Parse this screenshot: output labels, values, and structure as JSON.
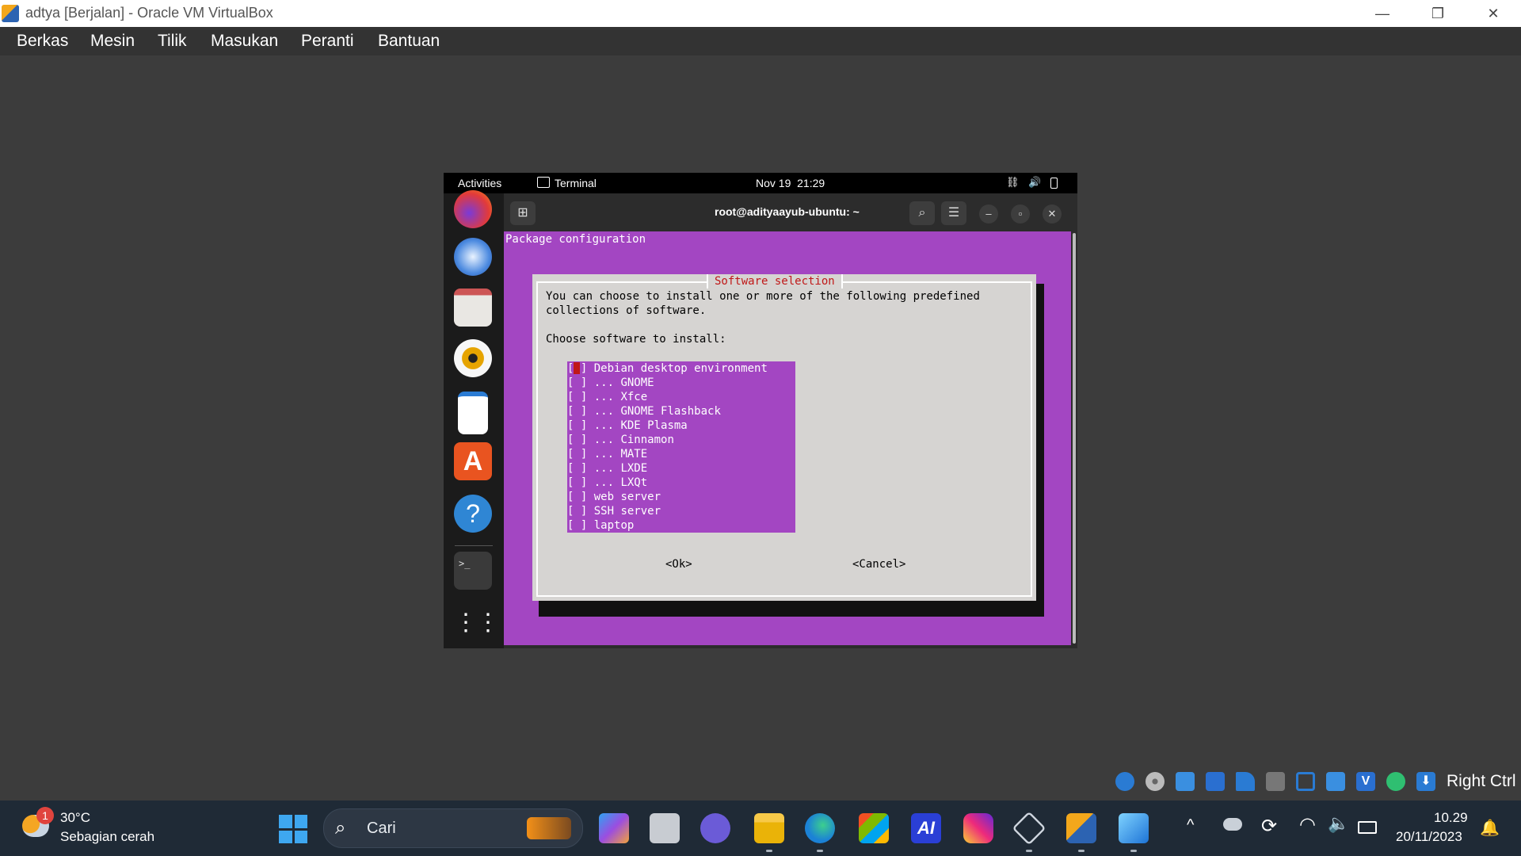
{
  "host_window": {
    "title": "adtya [Berjalan] - Oracle VM VirtualBox",
    "minimize": "—",
    "restore": "❐",
    "close": "✕"
  },
  "menu": [
    "Berkas",
    "Mesin",
    "Tilik",
    "Masukan",
    "Peranti",
    "Bantuan"
  ],
  "guest": {
    "topbar": {
      "activities": "Activities",
      "app": "Terminal",
      "clock": "Nov 19  21:29"
    },
    "dock_apps": [
      "firefox-icon",
      "thunderbird-icon",
      "files-icon",
      "rhythmbox-icon",
      "writer-icon",
      "app-center-icon",
      "help-icon",
      "terminal-icon",
      "show-apps-icon"
    ],
    "terminal": {
      "title": "root@adityaayub-ubuntu: ~",
      "header_line": "Package configuration",
      "dialog": {
        "title": "Software selection",
        "line1": "You can choose to install one or more of the following predefined",
        "line2": "collections of software.",
        "line3": "Choose software to install:",
        "items": [
          {
            "box": "[ ]",
            "label": "Debian desktop environment"
          },
          {
            "box": "[ ]",
            "label": "... GNOME"
          },
          {
            "box": "[ ]",
            "label": "... Xfce"
          },
          {
            "box": "[ ]",
            "label": "... GNOME Flashback"
          },
          {
            "box": "[ ]",
            "label": "... KDE Plasma"
          },
          {
            "box": "[ ]",
            "label": "... Cinnamon"
          },
          {
            "box": "[ ]",
            "label": "... MATE"
          },
          {
            "box": "[ ]",
            "label": "... LXDE"
          },
          {
            "box": "[ ]",
            "label": "... LXQt"
          },
          {
            "box": "[ ]",
            "label": "web server"
          },
          {
            "box": "[ ]",
            "label": "SSH server"
          },
          {
            "box": "[ ]",
            "label": "laptop"
          }
        ],
        "ok": "<Ok>",
        "cancel": "<Cancel>"
      }
    }
  },
  "vbox_status": {
    "host_key": "Right Ctrl"
  },
  "taskbar": {
    "weather_temp": "30°C",
    "weather_desc": "Sebagian cerah",
    "weather_badge": "1",
    "search_placeholder": "Cari",
    "time": "10.29",
    "date": "20/11/2023"
  },
  "colors": {
    "terminal_bg": "#a346c2",
    "dialog_bg": "#d6d4d2",
    "dialog_title": "#c01818",
    "taskbar_bg": "#1f2a36"
  }
}
